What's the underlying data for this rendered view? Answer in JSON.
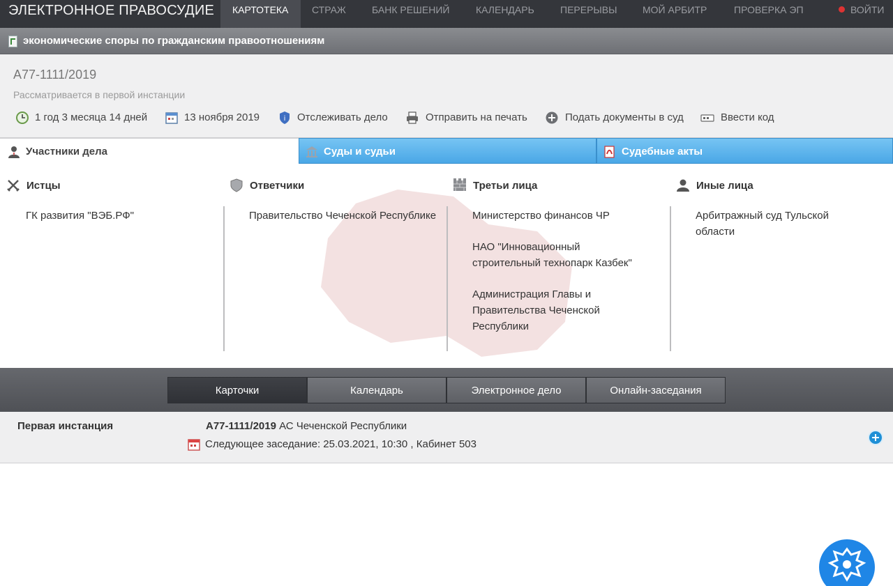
{
  "colors": {
    "nav_bg": "#34363b",
    "accent_tab": "#4aa7e6",
    "emblem": "#1f86e6",
    "logout_dot": "#dd3333"
  },
  "nav": {
    "brand": "ЭЛЕКТРОННОЕ ПРАВОСУДИЕ",
    "items": [
      {
        "label": "КАРТОТЕКА",
        "active": true
      },
      {
        "label": "СТРАЖ"
      },
      {
        "label": "БАНК РЕШЕНИЙ"
      },
      {
        "label": "КАЛЕНДАРЬ"
      },
      {
        "label": "ПЕРЕРЫВЫ"
      },
      {
        "label": "МОЙ АРБИТР"
      },
      {
        "label": "ПРОВЕРКА ЭП"
      }
    ],
    "logout": "ВОЙТИ"
  },
  "category": {
    "title": "экономические споры по гражданским правоотношениям",
    "icon": "document-icon"
  },
  "case": {
    "number": "А77-1111/2019",
    "status": "Рассматривается в первой инстанции",
    "actions": [
      {
        "label": "1 год 3 месяца 14 дней",
        "icon": "clock-icon"
      },
      {
        "label": "13 ноября 2019",
        "icon": "calendar-icon"
      },
      {
        "label": "Отслеживать дело",
        "icon": "shield-icon"
      },
      {
        "label": "Отправить на печать",
        "icon": "printer-icon"
      },
      {
        "label": "Подать документы в суд",
        "icon": "plus-circle-icon"
      },
      {
        "label": "Ввести код",
        "icon": "keyboard-icon"
      }
    ]
  },
  "tabs": [
    {
      "label": "Участники дела",
      "icon": "user-icon",
      "active": true
    },
    {
      "label": "Суды и судьи",
      "icon": "courthouse-icon"
    },
    {
      "label": "Судебные акты",
      "icon": "pdf-icon"
    }
  ],
  "parties": [
    {
      "heading": "Истцы",
      "icon": "crossed-swords-icon",
      "items": [
        "ГК развития \"ВЭБ.РФ\""
      ]
    },
    {
      "heading": "Ответчики",
      "icon": "shield-icon",
      "items": [
        "Правительство Чеченской Республике"
      ]
    },
    {
      "heading": "Третьи лица",
      "icon": "wall-icon",
      "items": [
        "Министерство финансов ЧР",
        "НАО \"Инновационный строительный технопарк Казбек\"",
        "Администрация Главы и Правительства Чеченской Республики"
      ]
    },
    {
      "heading": "Иные лица",
      "icon": "person-icon",
      "items": [
        "Арбитражный суд Тульской области"
      ]
    }
  ],
  "bottom_tabs": [
    {
      "label": "Карточки",
      "active": true
    },
    {
      "label": "Календарь"
    },
    {
      "label": "Электронное дело"
    },
    {
      "label": "Онлайн-заседания"
    }
  ],
  "instance": {
    "label": "Первая инстанция",
    "case_number": "А77-1111/2019",
    "court": "АС Чеченской Республики",
    "next_hearing": "Следующее заседание: 25.03.2021, 10:30 , Кабинет 503"
  }
}
